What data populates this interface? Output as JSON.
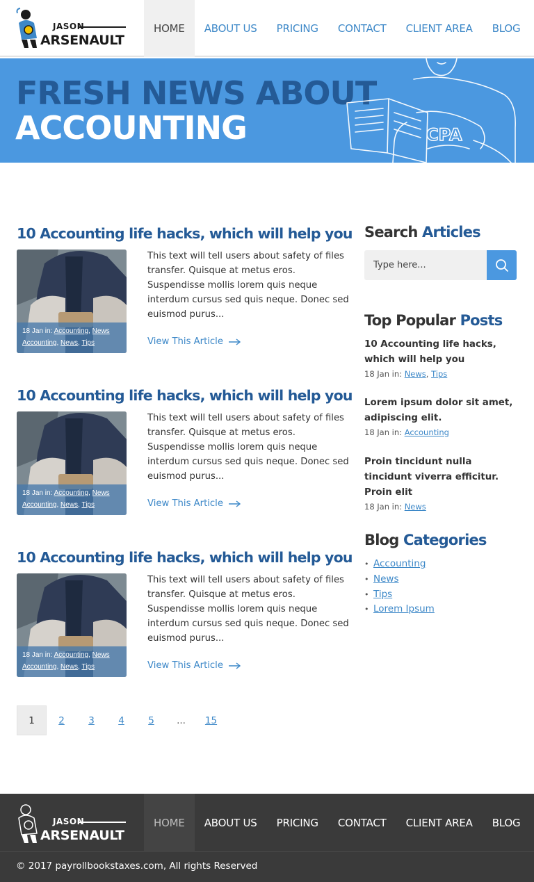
{
  "brand": {
    "name_top": "JASON",
    "name_bottom": "ARSENAULT"
  },
  "nav": {
    "items": [
      {
        "label": "Home",
        "active": true
      },
      {
        "label": "About Us",
        "active": false
      },
      {
        "label": "Pricing",
        "active": false
      },
      {
        "label": "Contact",
        "active": false
      },
      {
        "label": "Client Area",
        "active": false
      },
      {
        "label": "Blog",
        "active": false
      }
    ]
  },
  "banner": {
    "line1": "FRESH NEWS ABOUT",
    "line2": "ACCOUNTING",
    "art_text": "CPA"
  },
  "articles": [
    {
      "title": "10 Accounting life hacks, which will help you",
      "text": "This text will tell users about safety of files transfer. Quisque at metus eros. Suspendisse mollis lorem quis neque interdum cursus sed quis neque. Donec sed euismod purus...",
      "date": "18 Jan in:",
      "tags": [
        "Accounting",
        "News Accounting",
        "News",
        "Tips"
      ],
      "link": "View This Article"
    },
    {
      "title": "10 Accounting life hacks, which will help you",
      "text": "This text will tell users about safety of files transfer. Quisque at metus eros. Suspendisse mollis lorem quis neque interdum cursus sed quis neque. Donec sed euismod purus...",
      "date": "18 Jan in:",
      "tags": [
        "Accounting",
        "News Accounting",
        "News",
        "Tips"
      ],
      "link": "View This Article"
    },
    {
      "title": "10 Accounting life hacks, which will help you",
      "text": "This text will tell users about safety of files transfer. Quisque at metus eros. Suspendisse mollis lorem quis neque interdum cursus sed quis neque. Donec sed euismod purus...",
      "date": "18 Jan in:",
      "tags": [
        "Accounting",
        "News Accounting",
        "News",
        "Tips"
      ],
      "link": "View This Article"
    }
  ],
  "pagination": {
    "pages": [
      "1",
      "2",
      "3",
      "4",
      "5",
      "...",
      "15"
    ],
    "current": "1"
  },
  "sidebar": {
    "search": {
      "title_plain": "Search",
      "title_accent": "Articles",
      "placeholder": "Type here..."
    },
    "popular": {
      "title_plain": "Top Popular",
      "title_accent": "Posts",
      "posts": [
        {
          "title": "10 Accounting life hacks, which will help you",
          "date": "18 Jan in:",
          "tags": [
            "News",
            "Tips"
          ]
        },
        {
          "title": "Lorem ipsum dolor sit amet, adipiscing elit.",
          "date": "18 Jan in:",
          "tags": [
            "Accounting"
          ]
        },
        {
          "title": "Proin tincidunt nulla tincidunt viverra efficitur. Proin elit",
          "date": "18 Jan in:",
          "tags": [
            "News"
          ]
        }
      ]
    },
    "categories": {
      "title_plain": "Blog",
      "title_accent": "Categories",
      "items": [
        "Accounting",
        "News",
        "Tips",
        "Lorem Ipsum"
      ]
    }
  },
  "footer": {
    "copyright": "© 2017 payrollbookstaxes.com, All rights Reserved"
  },
  "colors": {
    "accent": "#3d88c8",
    "dark_blue": "#245a96",
    "banner_blue": "#4b98e0",
    "footer_bg": "#3a3a3a"
  }
}
